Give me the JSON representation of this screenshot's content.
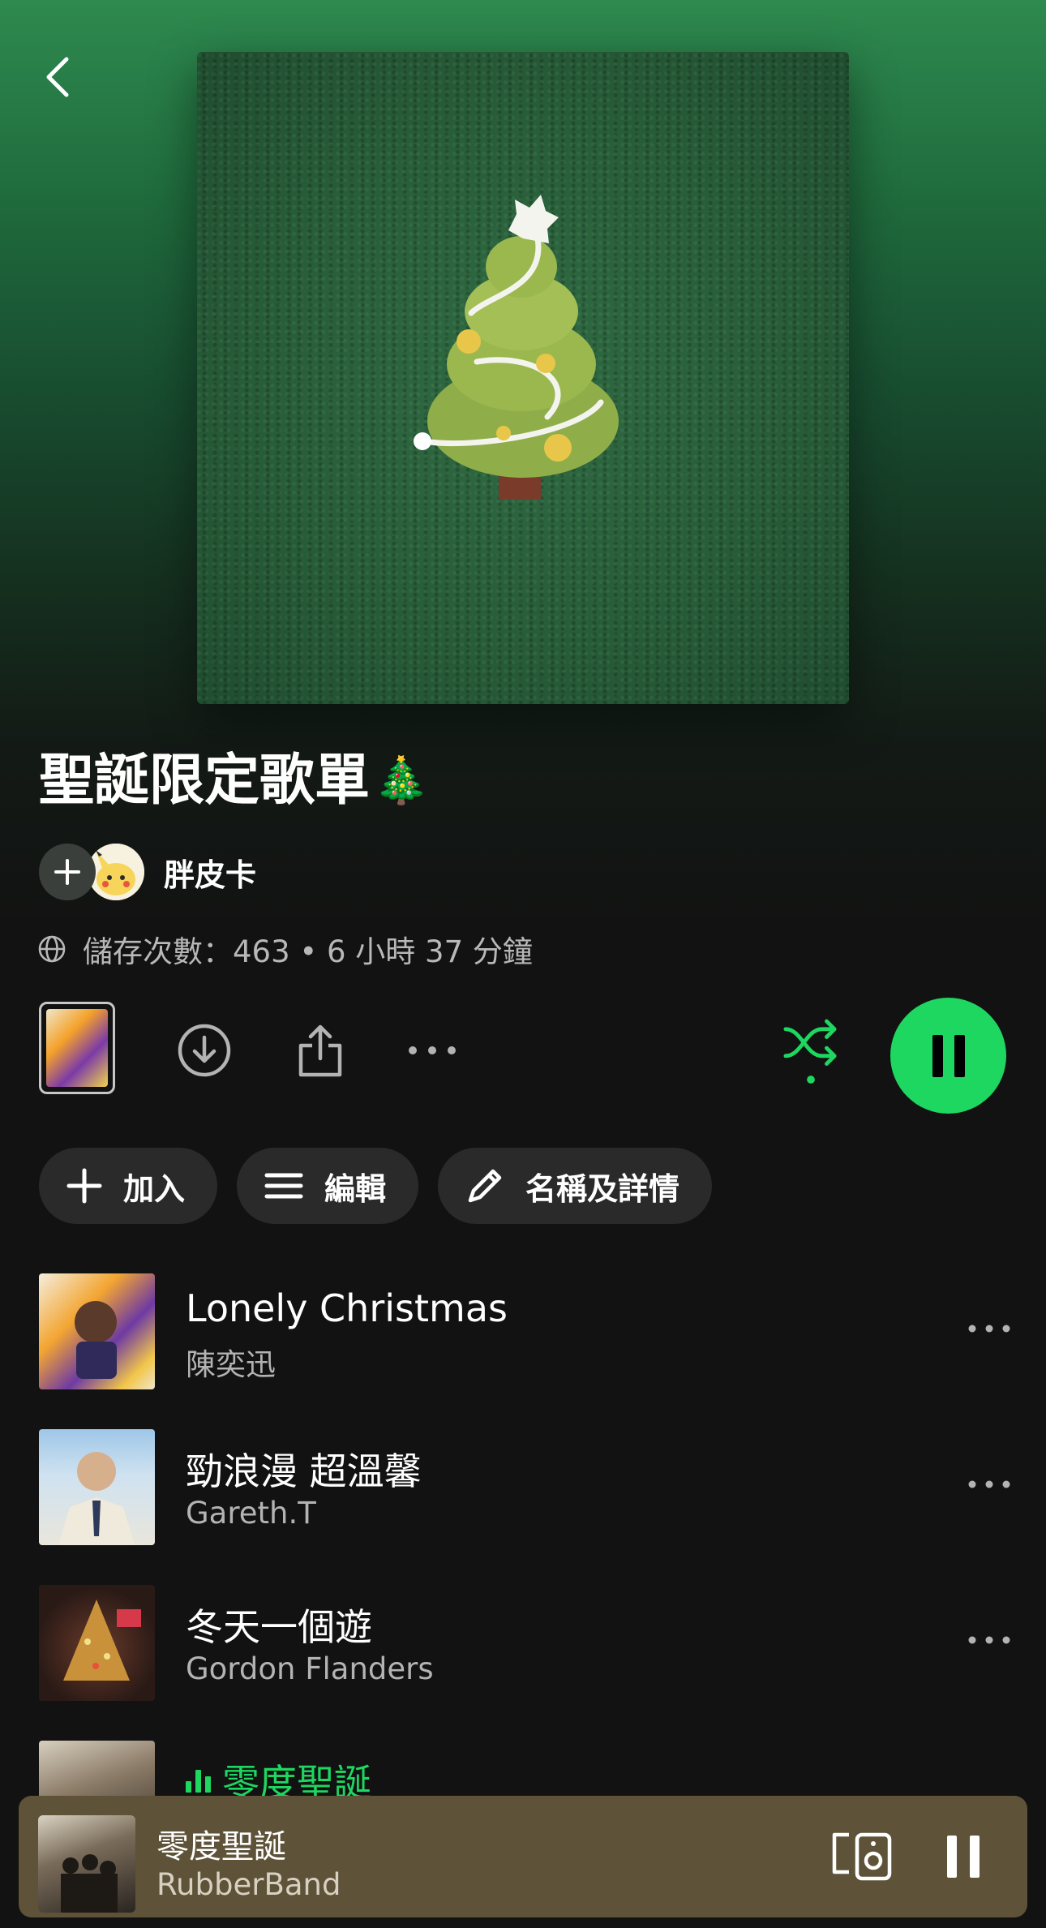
{
  "playlist": {
    "title": "聖誕限定歌單",
    "title_emoji": "🎄",
    "owner": "胖皮卡",
    "meta": "儲存次數：463 • 6 小時 37 分鐘",
    "cover_icon": "christmas-tree-icon"
  },
  "controls": {
    "download_icon": "download-icon",
    "share_icon": "share-icon",
    "more_icon": "more-icon",
    "shuffle_icon": "shuffle-icon",
    "play_state": "playing",
    "accent_color": "#1ed760"
  },
  "chips": [
    {
      "label": "加入",
      "icon": "plus-icon"
    },
    {
      "label": "編輯",
      "icon": "list-icon"
    },
    {
      "label": "名稱及詳情",
      "icon": "pencil-icon"
    }
  ],
  "tracks": [
    {
      "title": "Lonely Christmas",
      "artist": "陳奕迅",
      "playing": false
    },
    {
      "title": "勁浪漫 超溫馨",
      "artist": "Gareth.T",
      "playing": false
    },
    {
      "title": "冬天一個遊",
      "artist": "Gordon Flanders",
      "playing": false
    },
    {
      "title": "零度聖誕",
      "artist": "RubberBand",
      "playing": true
    }
  ],
  "now_playing": {
    "title": "零度聖誕",
    "artist": "RubberBand",
    "bar_color": "#5e5238"
  }
}
